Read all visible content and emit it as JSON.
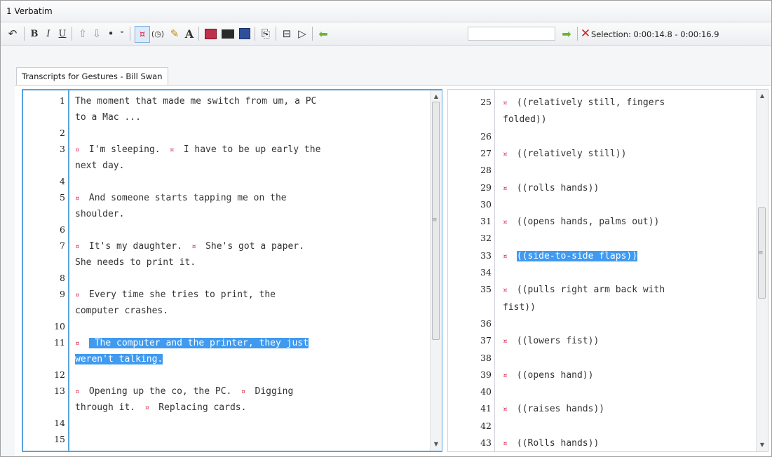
{
  "window": {
    "title": "1 Verbatim"
  },
  "toolbar": {
    "bold": "B",
    "italic": "I",
    "underline": "U",
    "font": "A",
    "selection": "Selection: 0:00:14.8 - 0:00:16.9"
  },
  "tab": {
    "label": "Transcripts for Gestures - Bill Swan"
  },
  "left": {
    "lines": [
      {
        "n": "1",
        "t": "The moment that made me switch from um, a PC"
      },
      {
        "n": "",
        "t": "to a Mac ..."
      },
      {
        "n": "2",
        "t": ""
      },
      {
        "n": "3",
        "t": "I'm sleeping.",
        "t2": "I have to be up early the"
      },
      {
        "n": "",
        "t": "next day."
      },
      {
        "n": "4",
        "t": ""
      },
      {
        "n": "5",
        "t": "And someone starts tapping me on the"
      },
      {
        "n": "",
        "t": "shoulder."
      },
      {
        "n": "6",
        "t": ""
      },
      {
        "n": "7",
        "t": "It's my daughter.",
        "t2": "She's got a paper."
      },
      {
        "n": "",
        "t": "She needs to print it."
      },
      {
        "n": "8",
        "t": ""
      },
      {
        "n": "9",
        "t": "Every time she tries to print, the"
      },
      {
        "n": "",
        "t": "computer crashes."
      },
      {
        "n": "10",
        "t": ""
      },
      {
        "n": "11",
        "t": " The computer and the printer, they just"
      },
      {
        "n": "",
        "t": "weren't talking."
      },
      {
        "n": "12",
        "t": ""
      },
      {
        "n": "13",
        "t": "Opening up the co, the PC.",
        "t2": "Digging"
      },
      {
        "n": "",
        "t": "through it.",
        "t2": "Replacing cards."
      },
      {
        "n": "14",
        "t": ""
      },
      {
        "n": "15",
        "t": ""
      }
    ]
  },
  "right": {
    "lines": [
      {
        "n": "25",
        "t": "((relatively still, fingers"
      },
      {
        "n": "",
        "t": "folded))"
      },
      {
        "n": "26",
        "t": ""
      },
      {
        "n": "27",
        "t": "((relatively still))"
      },
      {
        "n": "28",
        "t": ""
      },
      {
        "n": "29",
        "t": "((rolls hands))"
      },
      {
        "n": "30",
        "t": ""
      },
      {
        "n": "31",
        "t": "((opens hands, palms out))"
      },
      {
        "n": "32",
        "t": ""
      },
      {
        "n": "33",
        "t": "((side-to-side flaps))"
      },
      {
        "n": "34",
        "t": ""
      },
      {
        "n": "35",
        "t": "((pulls right arm back with"
      },
      {
        "n": "",
        "t": "fist))"
      },
      {
        "n": "36",
        "t": ""
      },
      {
        "n": "37",
        "t": "((lowers fist))"
      },
      {
        "n": "38",
        "t": ""
      },
      {
        "n": "39",
        "t": "((opens hand))"
      },
      {
        "n": "40",
        "t": ""
      },
      {
        "n": "41",
        "t": "((raises hands))"
      },
      {
        "n": "42",
        "t": ""
      },
      {
        "n": "43",
        "t": "((Rolls hands))"
      }
    ]
  },
  "icons": [
    "undo-icon",
    "bold-icon",
    "italic-icon",
    "underline-icon",
    "up-arrow-icon",
    "down-arrow-icon",
    "bullet-icon",
    "degree-icon",
    "marker-icon",
    "timer-icon",
    "clip-icon",
    "font-icon",
    "video-icon",
    "film-icon",
    "save-icon",
    "copy-icon",
    "split-icon",
    "play-icon",
    "back-icon",
    "forward-icon",
    "delete-icon"
  ],
  "colors": {
    "highlight": "#3f9af0",
    "marker": "#d8284a",
    "focus_border": "#5aa4dc"
  }
}
